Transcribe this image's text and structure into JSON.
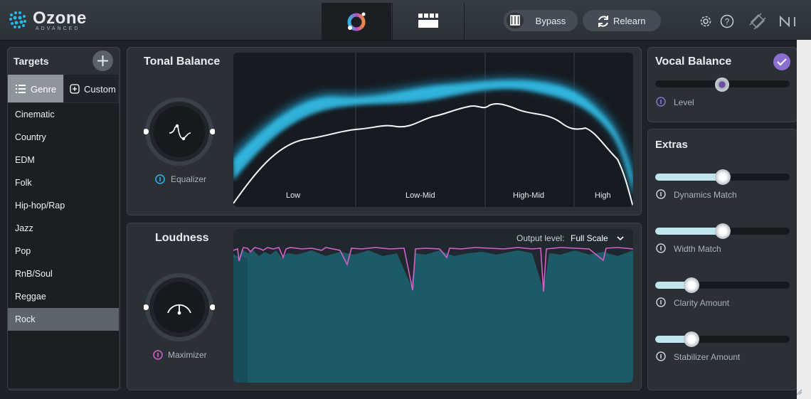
{
  "app": {
    "name": "Ozone",
    "edition": "ADVANCED"
  },
  "toolbar": {
    "bypass_label": "Bypass",
    "relearn_label": "Relearn",
    "icons": [
      "assistant-icon",
      "grid-view-icon",
      "bypass-icon",
      "relearn-icon",
      "gear-icon",
      "help-icon",
      "plugin-icon",
      "ni-logo"
    ]
  },
  "targets": {
    "title": "Targets",
    "tabs": [
      {
        "label": "Genre",
        "selected": true
      },
      {
        "label": "Custom",
        "selected": false
      }
    ],
    "genres": [
      "Cinematic",
      "Country",
      "EDM",
      "Folk",
      "Hip-hop/Rap",
      "Jazz",
      "Pop",
      "RnB/Soul",
      "Reggae",
      "Rock"
    ],
    "selected": "Rock"
  },
  "tonal_balance": {
    "title": "Tonal Balance",
    "module_label": "Equalizer",
    "bands": [
      "Low",
      "Low-Mid",
      "High-Mid",
      "High"
    ]
  },
  "loudness": {
    "title": "Loudness",
    "module_label": "Maximizer",
    "output_level_label": "Output level:",
    "output_level_value": "Full Scale"
  },
  "vocal_balance": {
    "title": "Vocal Balance",
    "enabled": true,
    "level_label": "Level",
    "level_value": 0.5
  },
  "extras": {
    "title": "Extras",
    "sliders": [
      {
        "label": "Dynamics Match",
        "value": 0.5
      },
      {
        "label": "Width Match",
        "value": 0.5
      },
      {
        "label": "Clarity Amount",
        "value": 0.27
      },
      {
        "label": "Stabilizer Amount",
        "value": 0.27
      }
    ]
  },
  "colors": {
    "accent_cyan": "#2fb6e0",
    "accent_purple": "#8b6fd0",
    "maximizer_pink": "#d461c6",
    "panel_bg": "#2b3037",
    "graph_bg": "#171b21"
  }
}
